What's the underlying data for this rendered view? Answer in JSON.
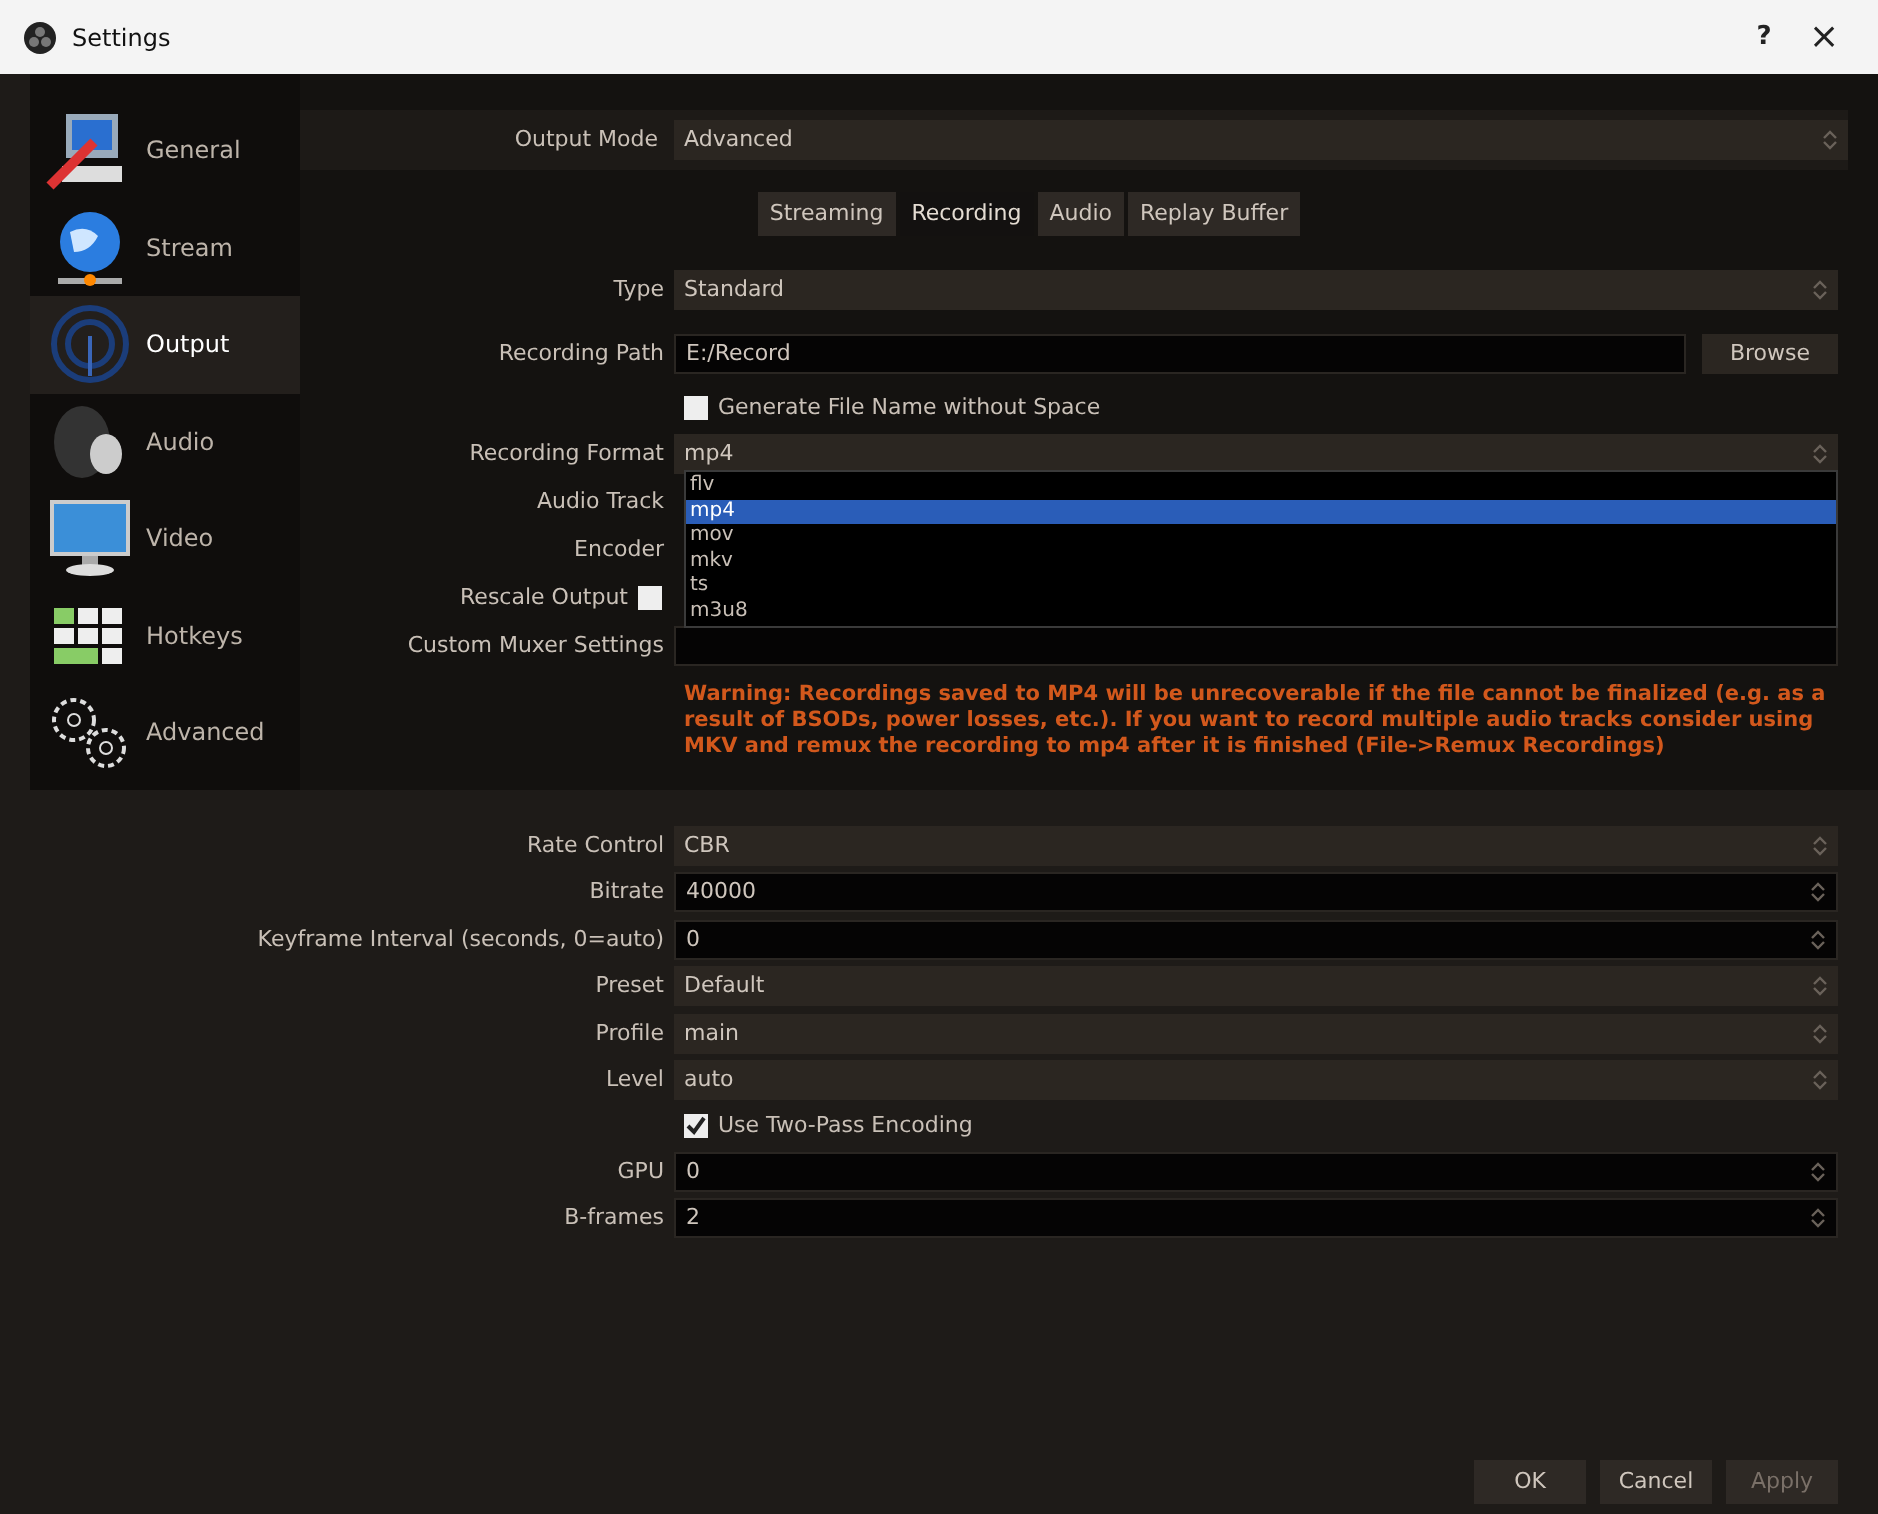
{
  "window": {
    "title": "Settings",
    "buttons": [
      "?",
      "×"
    ]
  },
  "sidebar": {
    "items": [
      {
        "label": "General",
        "selected": false
      },
      {
        "label": "Stream",
        "selected": false
      },
      {
        "label": "Output",
        "selected": true
      },
      {
        "label": "Audio",
        "selected": false
      },
      {
        "label": "Video",
        "selected": false
      },
      {
        "label": "Hotkeys",
        "selected": false
      },
      {
        "label": "Advanced",
        "selected": false
      }
    ]
  },
  "output_mode": {
    "label": "Output Mode",
    "value": "Advanced"
  },
  "tabs": [
    {
      "label": "Streaming",
      "selected": false
    },
    {
      "label": "Recording",
      "selected": true
    },
    {
      "label": "Audio",
      "selected": false
    },
    {
      "label": "Replay Buffer",
      "selected": false
    }
  ],
  "recording": {
    "rows": [
      {
        "kind": "select",
        "label": "Type",
        "value": "Standard"
      },
      {
        "kind": "path",
        "label": "Recording Path",
        "value": "E:/Record",
        "button": "Browse"
      },
      {
        "kind": "checkbox",
        "label": "Generate File Name without Space",
        "checked": false
      },
      {
        "kind": "format",
        "label": "Recording Format",
        "value": "mp4",
        "options": [
          {
            "label": "flv",
            "selected": false
          },
          {
            "label": "mp4",
            "selected": true
          },
          {
            "label": "mov",
            "selected": false
          },
          {
            "label": "mkv",
            "selected": false
          },
          {
            "label": "ts",
            "selected": false
          },
          {
            "label": "m3u8",
            "selected": false
          }
        ]
      },
      {
        "kind": "hidden",
        "label": "Audio Track"
      },
      {
        "kind": "hidden",
        "label": "Encoder"
      },
      {
        "kind": "labelcheck",
        "label": "Rescale Output",
        "checked": false
      },
      {
        "kind": "text",
        "label": "Custom Muxer Settings"
      }
    ],
    "warning": "Warning: Recordings saved to MP4 will be unrecoverable if the file cannot be finalized (e.g. as a result of BSODs, power losses, etc.). If you want to record multiple audio tracks consider using MKV and remux the recording to mp4 after it is finished (File->Remux Recordings)"
  },
  "encoder": {
    "rows": [
      {
        "kind": "select",
        "label": "Rate Control",
        "value": "CBR"
      },
      {
        "kind": "spin",
        "label": "Bitrate",
        "value": "40000"
      },
      {
        "kind": "spin",
        "label": "Keyframe Interval (seconds, 0=auto)",
        "value": "0"
      },
      {
        "kind": "select",
        "label": "Preset",
        "value": "Default"
      },
      {
        "kind": "select",
        "label": "Profile",
        "value": "main"
      },
      {
        "kind": "select",
        "label": "Level",
        "value": "auto"
      },
      {
        "kind": "checkbox",
        "label": "Use Two-Pass Encoding",
        "checked": true
      },
      {
        "kind": "spin",
        "label": "GPU",
        "value": "0"
      },
      {
        "kind": "spin",
        "label": "B-frames",
        "value": "2"
      }
    ]
  },
  "footer": {
    "buttons": [
      {
        "label": "OK",
        "disabled": false
      },
      {
        "label": "Cancel",
        "disabled": false
      },
      {
        "label": "Apply",
        "disabled": true
      }
    ]
  }
}
